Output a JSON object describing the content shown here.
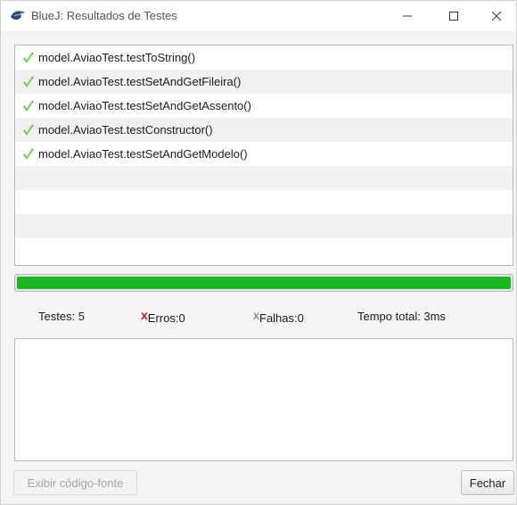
{
  "window": {
    "title": "BlueJ:  Resultados de Testes"
  },
  "results": [
    {
      "name": "model.AviaoTest.testToString()",
      "status": "passed"
    },
    {
      "name": "model.AviaoTest.testSetAndGetFileira()",
      "status": "passed"
    },
    {
      "name": "model.AviaoTest.testSetAndGetAssento()",
      "status": "passed"
    },
    {
      "name": "model.AviaoTest.testConstructor()",
      "status": "passed"
    },
    {
      "name": "model.AviaoTest.testSetAndGetModelo()",
      "status": "passed"
    }
  ],
  "progress": {
    "fraction": 1.0,
    "color": "#1db521"
  },
  "stats": {
    "tests_label": "Testes:  5",
    "errors_mark": "x",
    "errors_label": "Erros:0",
    "failures_mark": "x",
    "failures_label": "Falhas:0",
    "time_label": "Tempo total:  3ms"
  },
  "buttons": {
    "show_source": "Exibir código-fonte",
    "close": "Fechar"
  },
  "colors": {
    "pass_check": "#5cc23a",
    "error_mark": "#c81b1b",
    "failure_mark": "#6e6e6e"
  }
}
